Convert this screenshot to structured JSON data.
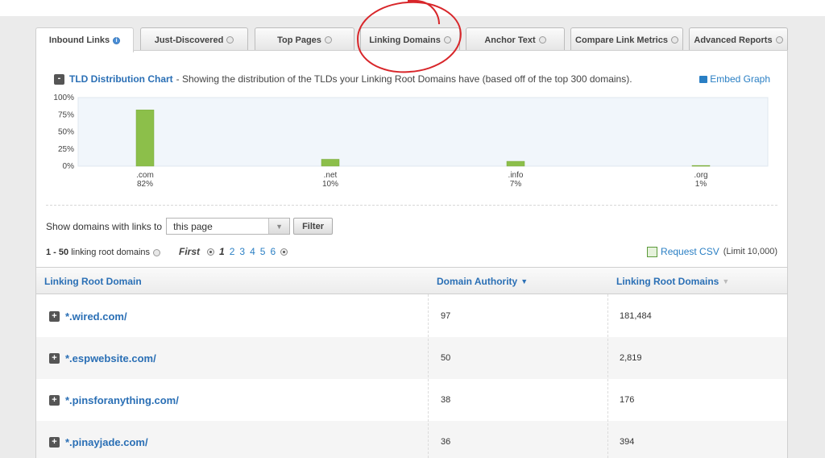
{
  "tabs": [
    {
      "label": "Inbound Links",
      "icon": "info-icon"
    },
    {
      "label": "Just-Discovered",
      "icon": "help-icon"
    },
    {
      "label": "Top Pages",
      "icon": "help-icon"
    },
    {
      "label": "Linking Domains",
      "icon": "help-icon"
    },
    {
      "label": "Anchor Text",
      "icon": "help-icon"
    },
    {
      "label": "Compare Link Metrics",
      "icon": "help-icon"
    },
    {
      "label": "Advanced Reports",
      "icon": "help-icon"
    }
  ],
  "chart_header": {
    "collapse": "-",
    "title": "TLD Distribution Chart",
    "description": "- Showing the distribution of the TLDs your Linking Root Domains have (based off of the top 300 domains).",
    "embed_label": "Embed Graph"
  },
  "chart_data": {
    "type": "bar",
    "categories": [
      ".com",
      ".net",
      ".info",
      ".org"
    ],
    "values": [
      82,
      10,
      7,
      1
    ],
    "value_labels": [
      "82%",
      "10%",
      "7%",
      "1%"
    ],
    "ylim": [
      0,
      100
    ],
    "yticks": [
      "0%",
      "25%",
      "50%",
      "75%",
      "100%"
    ],
    "title": "",
    "xlabel": "",
    "ylabel": "",
    "bar_color": "#8cbf4a",
    "grid": false
  },
  "filter": {
    "label": "Show domains with links to",
    "selected": "this page",
    "button": "Filter"
  },
  "results": {
    "range": "1 - 50",
    "label": "linking root domains",
    "pager_first": "First",
    "pages": [
      "1",
      "2",
      "3",
      "4",
      "5",
      "6"
    ],
    "csv_label": "Request CSV",
    "csv_limit": "(Limit 10,000)"
  },
  "table": {
    "columns": [
      "Linking Root Domain",
      "Domain Authority",
      "Linking Root Domains"
    ],
    "rows": [
      {
        "domain": "*.wired.com/",
        "da": "97",
        "lrd": "181,484"
      },
      {
        "domain": "*.espwebsite.com/",
        "da": "50",
        "lrd": "2,819"
      },
      {
        "domain": "*.pinsforanything.com/",
        "da": "38",
        "lrd": "176"
      },
      {
        "domain": "*.pinayjade.com/",
        "da": "36",
        "lrd": "394"
      }
    ]
  },
  "colors": {
    "link": "#2a6fb5",
    "accent_red": "#d8262a",
    "bar": "#8cbf4a"
  }
}
